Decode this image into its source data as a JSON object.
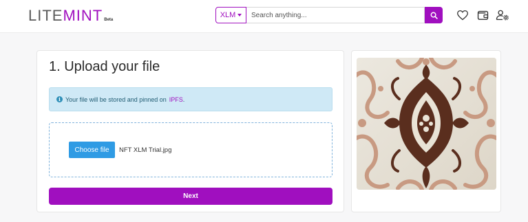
{
  "brand": {
    "lite": "LITE",
    "mint": "MINT",
    "beta": "Beta"
  },
  "search": {
    "currency": "XLM",
    "placeholder": "Search anything..."
  },
  "icons": {
    "search": "search-icon",
    "favorites": "heart-icon",
    "wallet": "wallet-icon",
    "account": "user-settings-icon"
  },
  "upload": {
    "title": "1. Upload your file",
    "info_text": "Your file will be stored and pinned on",
    "info_link": "IPFS",
    "info_end": ".",
    "choose_label": "Choose file",
    "file_name": "NFT XLM Trial.jpg",
    "next_label": "Next"
  },
  "colors": {
    "accent": "#a00fbf",
    "info_bg": "#cfe9f6",
    "choose_btn": "#2f9be4"
  }
}
